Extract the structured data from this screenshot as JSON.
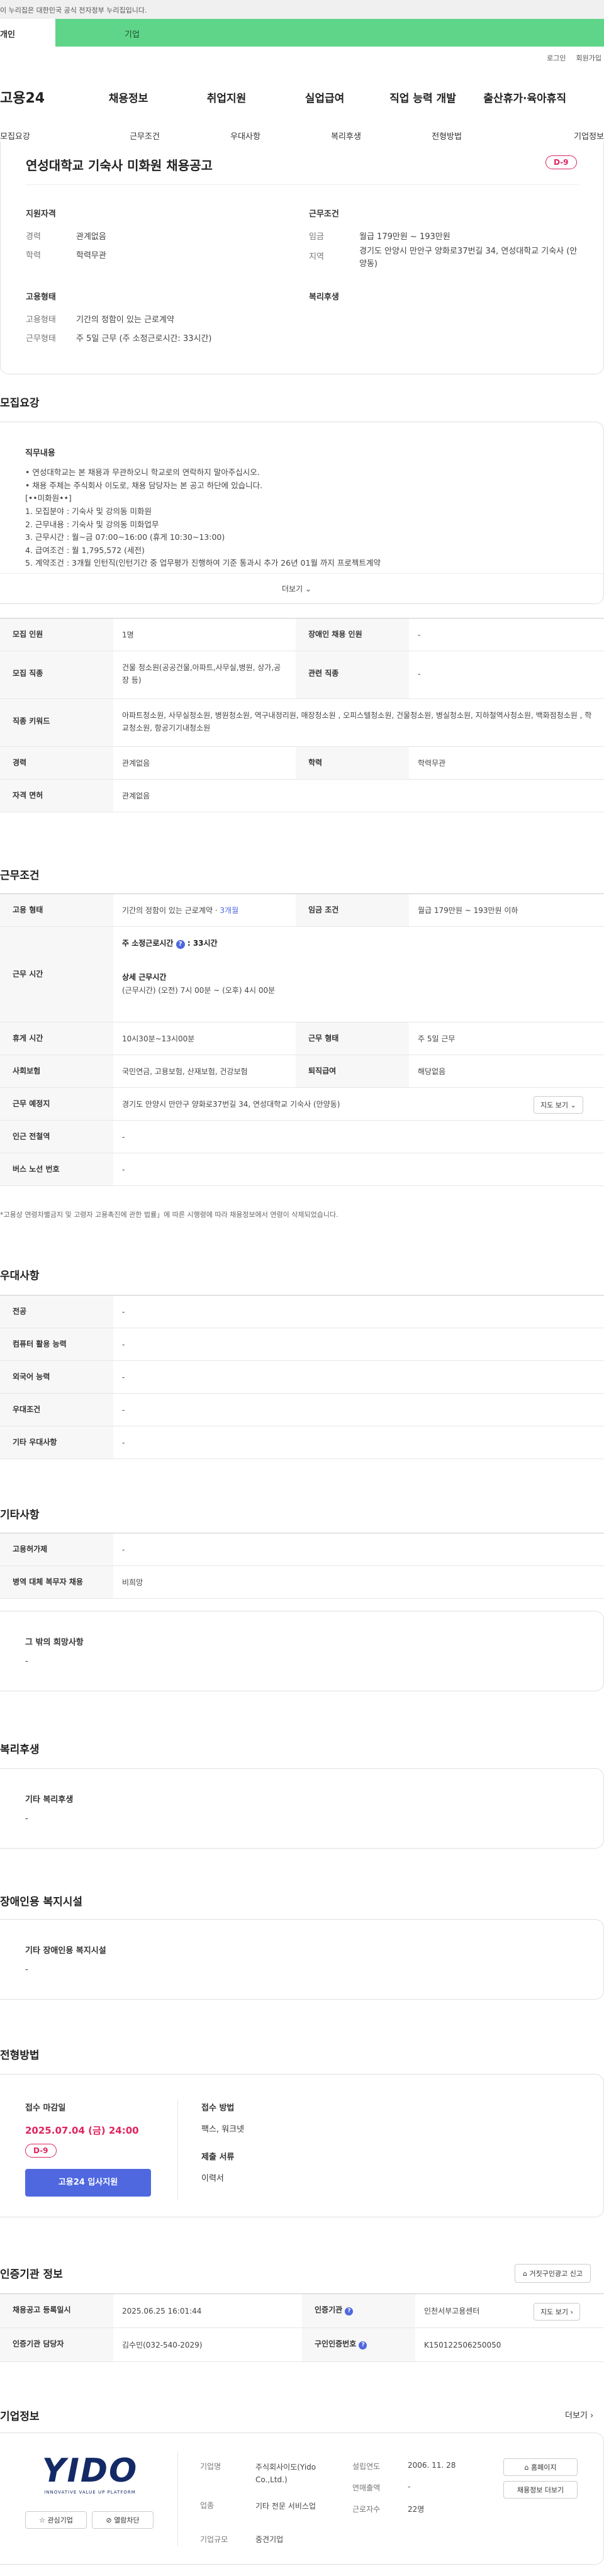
{
  "gov_banner": "이 누리집은 대한민국 공식 전자정부 누리집입니다.",
  "tabs": {
    "individual": "개인",
    "enterprise": "기업"
  },
  "util": {
    "login": "로그인",
    "join": "회원가입"
  },
  "gnb": {
    "logo": "고용24",
    "items": [
      "채용정보",
      "취업지원",
      "실업급여",
      "직업 능력 개발",
      "출산휴가·육아휴직"
    ]
  },
  "subnav": [
    "모집요강",
    "근무조건",
    "우대사항",
    "복리후생",
    "전형방법",
    "기업정보"
  ],
  "summary": {
    "title": "연성대학교 기숙사 미화원 채용공고",
    "dday": "D-9",
    "qual_title": "지원자격",
    "career_label": "경력",
    "career": "관계없음",
    "edu_label": "학력",
    "edu": "학력무관",
    "cond_title": "근무조건",
    "wage_label": "임금",
    "wage": "월급 179만원 ~ 193만원",
    "loc_label": "지역",
    "loc": "경기도 안양시 만안구 양화로37번길 34, 연성대학교 기숙사 (안양동)",
    "emp_title": "고용형태",
    "emptype_label": "고용형태",
    "emptype": "기간의 정함이 있는 근로계약",
    "worktype_label": "근무형태",
    "worktype": "주 5일 근무 (주 소정근로시간: 33시간)",
    "welfare_title": "복리후생"
  },
  "recruit": {
    "title": "모집요강",
    "duty_title": "직무내용",
    "duty_lines": [
      "• 연성대학교는 본 채용과 무관하오니 학교로의 연락하지 말아주십시오.",
      "• 채용 주체는 주식회사 이도로, 채용 담당자는 본 공고 하단에 있습니다.",
      "[••미화원••]",
      "1. 모집분야 : 기숙사 및 강의동 미화원",
      "2. 근무내용 : 기숙사 및 강의동 미화업무",
      "3. 근무시간 : 월~금 07:00~16:00 (휴게 10:30~13:00)",
      "4. 급여조건 : 월 1,795,572 (세전)",
      "5. 계약조건 : 3개월 인턴직(인턴기간 중 업무평가 진행하여 기준 통과시 추가 26년 01월 까지 프로젝트계약"
    ],
    "more": "더보기",
    "rows": [
      {
        "k1": "모집 인원",
        "v1": "1명",
        "k2": "장애인 채용 인원",
        "v2": "-"
      },
      {
        "k1": "모집 직종",
        "v1": "건물 청소원(공공건물,아파트,사무실,병원, 상가,공장 등)",
        "k2": "관련 직종",
        "v2": "-"
      },
      {
        "k1": "직종 키워드",
        "v1": "아파트청소원, 사무실청소원, 병원청소원, 역구내정리원, 매장청소원 , 오피스텔청소원, 건물청소원, 병실청소원, 지하철역사청소원, 백화점청소원 , 학교청소원, 항공기기내청소원"
      },
      {
        "k1": "경력",
        "v1": "관계없음",
        "k2": "학력",
        "v2": "학력무관"
      },
      {
        "k1": "자격 면허",
        "v1": "관계없음"
      }
    ]
  },
  "conditions": {
    "title": "근무조건",
    "emptype_label": "고용 형태",
    "emptype": "기간의 정함이 있는 근로계약",
    "emptype_months": "3개월",
    "wage_label": "임금 조건",
    "wage": "월급 179만원 ~ 193만원 이하",
    "hours_label": "근무 시간",
    "hours_total_prefix": "주 소정근로시간",
    "hours_total": ": 33시간",
    "detail_label": "상세 근무시간",
    "detail": "(근무시간) (오전) 7시 00분 ~ (오후) 4시 00분",
    "break_label": "휴게 시간",
    "break": "10시30분~13시00분",
    "shift_label": "근무 형태",
    "shift": "주 5일 근무",
    "ins_label": "사회보험",
    "ins": "국민연금, 고용보험, 산재보험, 건강보험",
    "sev_label": "퇴직급여",
    "sev": "해당없음",
    "place_label": "근무 예정지",
    "place": "경기도 안양시 만안구 양화로37번길 34, 연성대학교 기숙사 (안양동)",
    "map_btn": "지도 보기",
    "subway_label": "인근 전철역",
    "subway": "-",
    "bus_label": "버스 노선 번호",
    "bus": "-",
    "note": "*고용상 연령차별금지 및 고령자 고용촉진에 관한 법률」에 따른 시행령에 따라 채용정보에서 연령이 삭제되었습니다."
  },
  "pref": {
    "title": "우대사항",
    "rows": [
      {
        "k": "전공",
        "v": "-"
      },
      {
        "k": "컴퓨터 활용 능력",
        "v": "-"
      },
      {
        "k": "외국어 능력",
        "v": "-"
      },
      {
        "k": "우대조건",
        "v": "-"
      },
      {
        "k": "기타 우대사항",
        "v": "-"
      }
    ]
  },
  "other": {
    "title": "기타사항",
    "rows": [
      {
        "k": "고용허가제",
        "v": "-"
      },
      {
        "k": "병역 대체 복무자 채용",
        "v": "비희망"
      }
    ],
    "hope_title": "그 밖의 희망사항",
    "hope": "-"
  },
  "welfare": {
    "title": "복리후생",
    "box_title": "기타 복리후생",
    "box_val": "-"
  },
  "disab": {
    "title": "장애인용 복지시설",
    "box_title": "기타 장애인용 복지시설",
    "box_val": "-"
  },
  "selection": {
    "title": "전형방법",
    "deadline_label": "접수 마감일",
    "deadline": "2025.07.04 (금) 24:00",
    "dday": "D-9",
    "apply_btn": "고용24 입사지원",
    "method_label": "접수 방법",
    "method": "팩스, 워크넷",
    "docs_label": "제출 서류",
    "docs": "이력서"
  },
  "agency": {
    "title": "인증기관 정보",
    "report_btn": "거짓구인광고 신고",
    "reg_label": "채용공고 등록일시",
    "reg": "2025.06.25 16:01:44",
    "inst_label": "인증기관",
    "inst": "인천서부고용센터",
    "map_btn": "지도 보기",
    "mgr_label": "인증기관 담당자",
    "mgr": "김수민(032-540-2029)",
    "num_label": "구인인증번호",
    "num": "K150122506250050"
  },
  "company": {
    "title": "기업정보",
    "more": "더보기",
    "logo_text": "YIDO",
    "logo_sub": "INNOVATIVE VALUE UP PLATFORM",
    "fav_btn": "관심기업",
    "block_btn": "열람차단",
    "name_label": "기업명",
    "name": "주식회사이도(Yido Co.,Ltd.)",
    "founded_label": "설립연도",
    "founded": "2006. 11. 28",
    "home_btn": "홈페이지",
    "sales_label": "연매출액",
    "sales": "-",
    "industry_label": "업종",
    "industry": "기타 전문 서비스업",
    "emp_label": "근로자수",
    "emp": "22명",
    "jobs_btn": "채용정보 더보기",
    "size_label": "기업규모",
    "size": "중견기업"
  },
  "colors": {
    "accent": "#5fd58a",
    "dday": "#e0245e",
    "apply": "#4f68e0"
  }
}
